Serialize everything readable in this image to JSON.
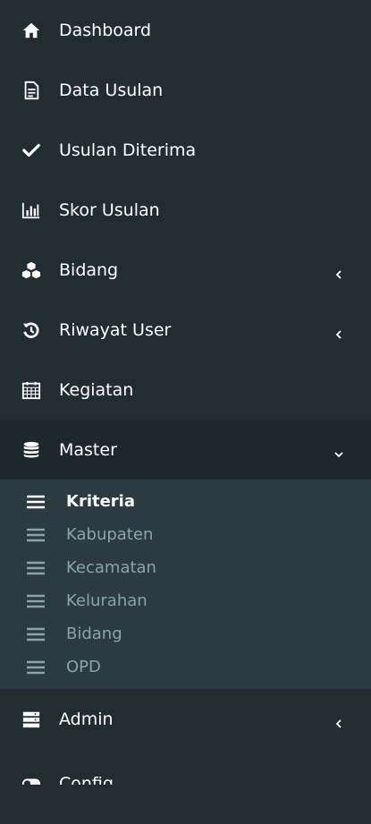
{
  "colors": {
    "background": "#222d32",
    "active_background": "#1e282c",
    "submenu_background": "#2c3b41",
    "submenu_text": "#8aa4af",
    "text": "#ffffff"
  },
  "menu": {
    "items": [
      {
        "label": "Dashboard",
        "icon": "home-icon"
      },
      {
        "label": "Data Usulan",
        "icon": "file-text-icon"
      },
      {
        "label": "Usulan Diterima",
        "icon": "check-icon"
      },
      {
        "label": "Skor Usulan",
        "icon": "bar-chart-icon"
      },
      {
        "label": "Bidang",
        "icon": "cubes-icon",
        "chevron": "left"
      },
      {
        "label": "Riwayat User",
        "icon": "history-icon",
        "chevron": "left"
      },
      {
        "label": "Kegiatan",
        "icon": "calendar-icon"
      },
      {
        "label": "Master",
        "icon": "database-icon",
        "chevron": "down"
      },
      {
        "label": "Admin",
        "icon": "server-icon",
        "chevron": "left"
      },
      {
        "label": "Config",
        "icon": "toggle-icon"
      }
    ],
    "master_submenu": [
      {
        "label": "Kriteria",
        "active": true
      },
      {
        "label": "Kabupaten"
      },
      {
        "label": "Kecamatan"
      },
      {
        "label": "Kelurahan"
      },
      {
        "label": "Bidang"
      },
      {
        "label": "OPD"
      }
    ]
  }
}
